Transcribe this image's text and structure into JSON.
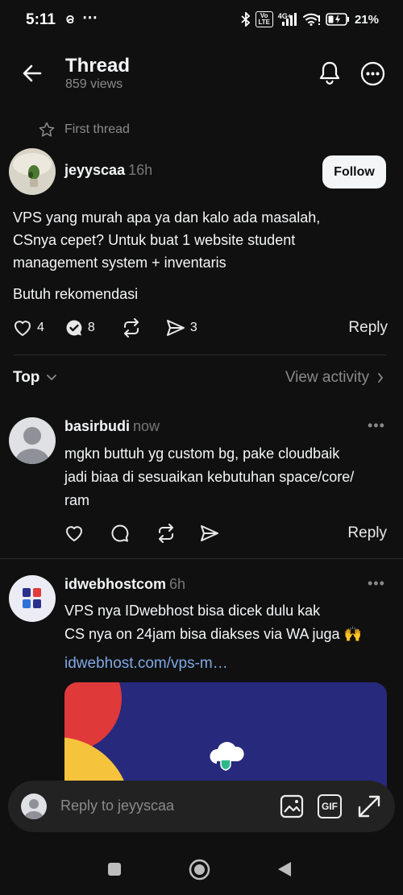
{
  "status_bar": {
    "time": "5:11",
    "extra": "⋯",
    "volte": "Vo LTE",
    "network": "4G+",
    "battery": "21%"
  },
  "header": {
    "title": "Thread",
    "views": "859 views"
  },
  "first_thread": "First thread",
  "post": {
    "username": "jeyyscaa",
    "time": "16h",
    "follow_label": "Follow",
    "text_lines": [
      "VPS yang murah apa ya dan kalo ada masalah,",
      "CSnya cepet? Untuk buat 1 website student",
      "management system + inventaris"
    ],
    "text_2": "Butuh rekomendasi",
    "likes": "4",
    "comments": "8",
    "shares": "3",
    "reply_label": "Reply"
  },
  "sort": {
    "label": "Top",
    "view_activity": "View activity"
  },
  "comments": [
    {
      "username": "basirbudi",
      "time": "now",
      "lines": [
        "mgkn buttuh yg custom bg, pake cloudbaik",
        "jadi biaa di sesuaikan kebutuhan space/core/",
        "ram"
      ],
      "reply_label": "Reply"
    },
    {
      "username": "idwebhostcom",
      "time": "6h",
      "lines": [
        "VPS nya IDwebhost bisa dicek dulu kak",
        "CS nya on 24jam bisa diakses via WA juga 🙌"
      ],
      "link": "idwebhost.com/vps-m…"
    }
  ],
  "reply_bar": {
    "placeholder": "Reply to jeyyscaa",
    "gif_label": "GIF"
  },
  "colors": {
    "background": "#101010",
    "link": "#7ea9e6",
    "preview": "#27297c"
  }
}
